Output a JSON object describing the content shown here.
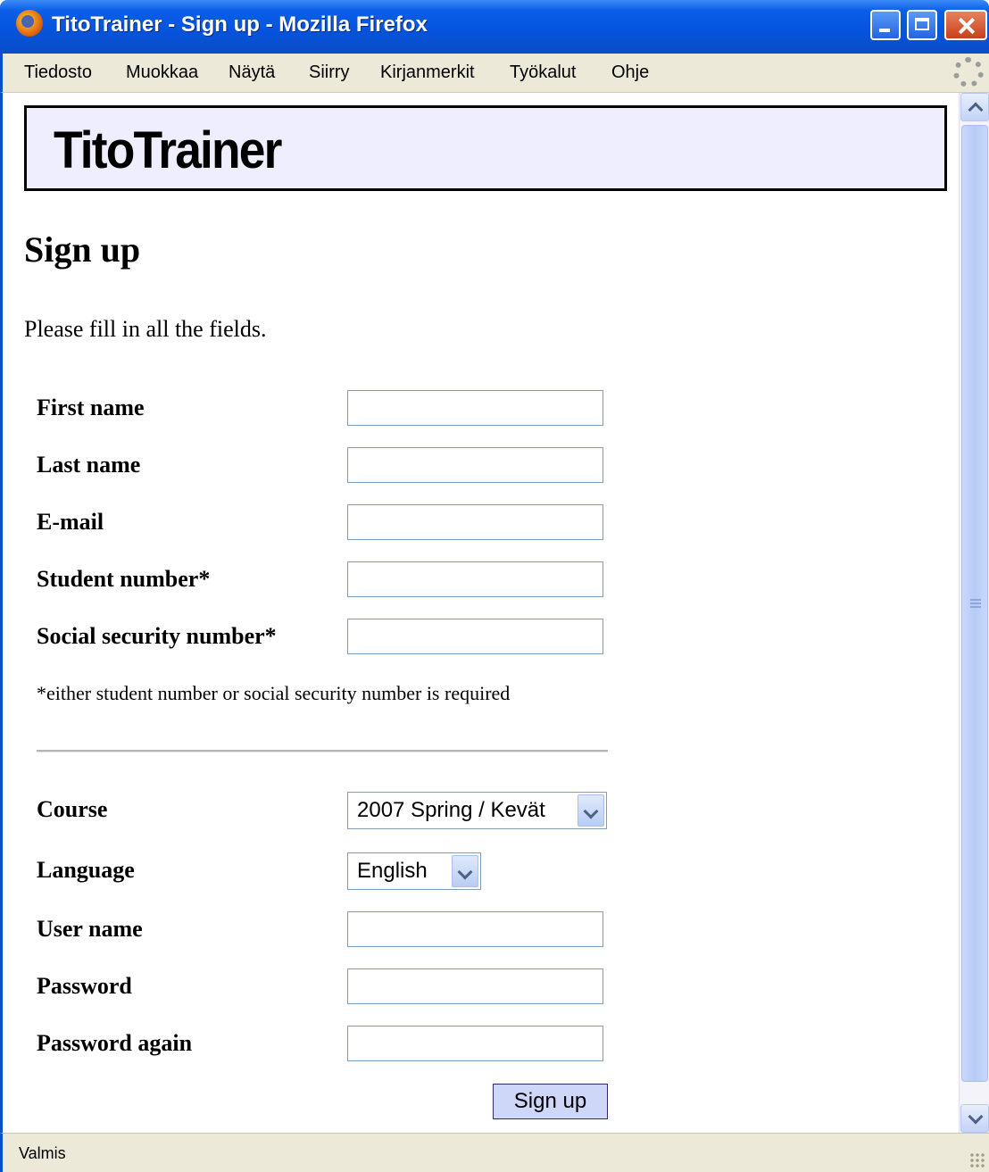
{
  "window": {
    "title": "TitoTrainer - Sign up - Mozilla Firefox"
  },
  "menu": [
    "Tiedosto",
    "Muokkaa",
    "Näytä",
    "Siirry",
    "Kirjanmerkit",
    "Työkalut",
    "Ohje"
  ],
  "banner": {
    "title": "TitoTrainer"
  },
  "page": {
    "heading": "Sign up",
    "intro": "Please fill in all the fields."
  },
  "form": {
    "first_name_label": "First name",
    "last_name_label": "Last name",
    "email_label": "E-mail",
    "student_number_label": "Student number*",
    "ssn_label": "Social security number*",
    "note": "*either student number or social security number is required",
    "course_label": "Course",
    "course_value": "2007 Spring / Kevät",
    "language_label": "Language",
    "language_value": "English",
    "username_label": "User name",
    "password_label": "Password",
    "password_again_label": "Password again",
    "submit_label": "Sign up",
    "first_name_value": "",
    "last_name_value": "",
    "email_value": "",
    "student_number_value": "",
    "ssn_value": "",
    "username_value": "",
    "password_value": "",
    "password_again_value": ""
  },
  "status": {
    "text": "Valmis"
  },
  "icons": {
    "app": "firefox-icon",
    "throbber": "throbber-icon"
  },
  "colors": {
    "titlebar": "#0a5ee8",
    "banner_bg": "#eeeeff",
    "submit_bg": "#cfd7f8",
    "chrome_bg": "#ece9d8"
  }
}
